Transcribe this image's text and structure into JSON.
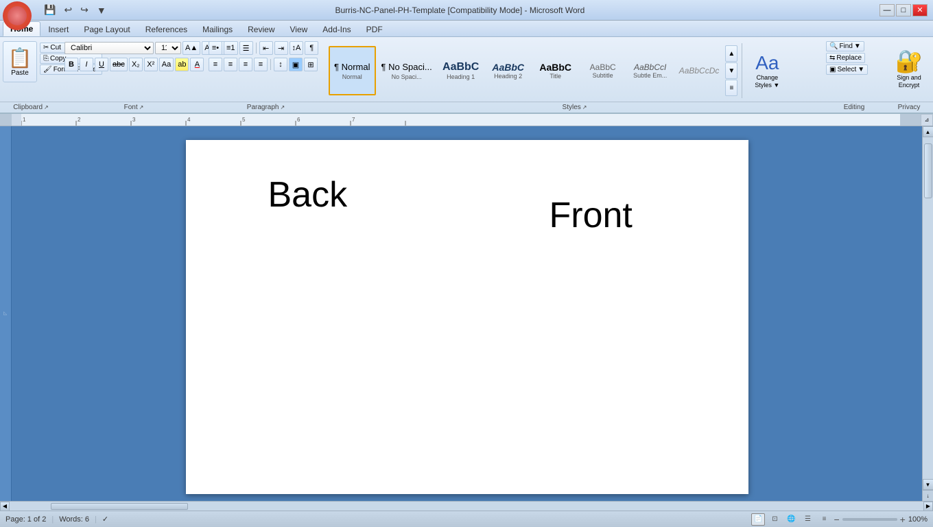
{
  "titlebar": {
    "title": "Burris-NC-Panel-PH-Template [Compatibility Mode] - Microsoft Word",
    "quickaccess": [
      "💾",
      "↩",
      "↪",
      "▼"
    ]
  },
  "ribbon": {
    "tabs": [
      "Home",
      "Insert",
      "Page Layout",
      "References",
      "Mailings",
      "Review",
      "View",
      "Add-Ins",
      "PDF"
    ],
    "active_tab": "Home",
    "sections": {
      "clipboard": {
        "label": "Clipboard",
        "paste_label": "Paste",
        "cut": "Cut",
        "copy": "Copy",
        "format_painter": "Format Painter"
      },
      "font": {
        "label": "Font",
        "font_name": "Calibri",
        "font_size": "11",
        "bold": "B",
        "italic": "I",
        "underline": "U",
        "strikethrough": "abc",
        "subscript": "X₂",
        "superscript": "X²",
        "change_case": "Aa",
        "highlight": "ab",
        "font_color": "A"
      },
      "paragraph": {
        "label": "Paragraph"
      },
      "styles": {
        "label": "Styles",
        "items": [
          {
            "preview": "¶ Normal",
            "label": "Normal",
            "active": true
          },
          {
            "preview": "¶ No Spaci...",
            "label": "No Spaci...",
            "active": false
          },
          {
            "preview": "Heading 1",
            "label": "Heading 1",
            "active": false
          },
          {
            "preview": "Heading 2",
            "label": "Heading 2",
            "active": false
          },
          {
            "preview": "Title",
            "label": "Title",
            "active": false
          },
          {
            "preview": "Subtitle",
            "label": "Subtitle",
            "active": false
          },
          {
            "preview": "Subtle Em...",
            "label": "Subtle Em...",
            "active": false
          },
          {
            "preview": "AaBbCcDc",
            "label": "",
            "active": false
          }
        ]
      },
      "change_styles": {
        "label": "Change\nStyles",
        "btn_label": "Change\nStyles"
      },
      "editing": {
        "label": "Editing",
        "find": "Find",
        "replace": "Replace",
        "select": "Select"
      },
      "privacy": {
        "label": "Privacy",
        "sign_encrypt": "Sign and\nEncrypt"
      }
    }
  },
  "document": {
    "text_back": "Back",
    "text_front": "Front"
  },
  "statusbar": {
    "page_info": "Page: 1 of 2",
    "words": "Words: 6",
    "zoom": "100%"
  }
}
